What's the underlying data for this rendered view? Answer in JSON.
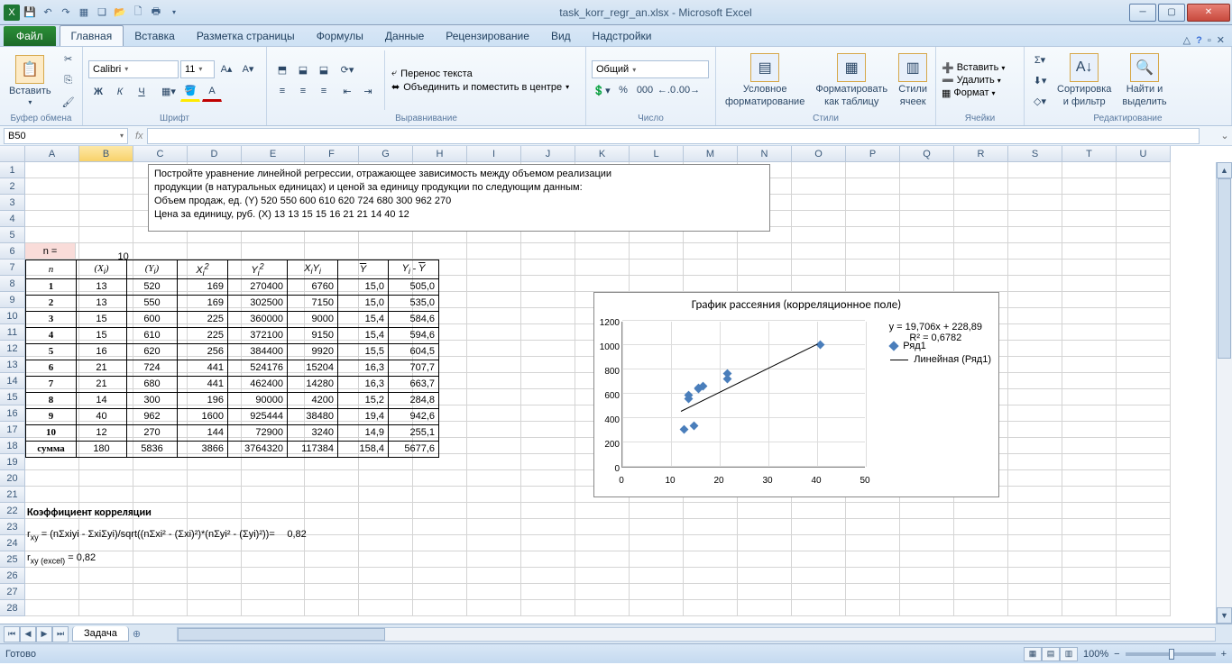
{
  "title": "task_korr_regr_an.xlsx - Microsoft Excel",
  "tabs": {
    "file": "Файл",
    "home": "Главная",
    "insert": "Вставка",
    "layout": "Разметка страницы",
    "formulas": "Формулы",
    "data": "Данные",
    "review": "Рецензирование",
    "view": "Вид",
    "addins": "Надстройки"
  },
  "ribbon": {
    "paste": "Вставить",
    "clipboard": "Буфер обмена",
    "font": "Calibri",
    "size": "11",
    "font_group": "Шрифт",
    "wrap": "Перенос текста",
    "merge": "Объединить и поместить в центре",
    "align_group": "Выравнивание",
    "numfmt": "Общий",
    "num_group": "Число",
    "cond": "Условное",
    "cond2": "форматирование",
    "fmttbl": "Форматировать",
    "fmttbl2": "как таблицу",
    "cellst": "Стили",
    "cellst2": "ячеек",
    "styles_group": "Стили",
    "ins": "Вставить",
    "del": "Удалить",
    "fmt": "Формат",
    "cells_group": "Ячейки",
    "sort": "Сортировка",
    "sort2": "и фильтр",
    "find": "Найти и",
    "find2": "выделить",
    "edit_group": "Редактирование"
  },
  "namebox": "B50",
  "fx": "fx",
  "cols": [
    "A",
    "B",
    "C",
    "D",
    "E",
    "F",
    "G",
    "H",
    "I",
    "J",
    "K",
    "L",
    "M",
    "N",
    "O",
    "P",
    "Q",
    "R",
    "S",
    "T",
    "U"
  ],
  "task": {
    "l1": "Постройте уравнение линейной регрессии, отражающее зависимость между  объемом реализации",
    "l2": "продукции (в натуральных единицах) и ценой за единицу продукции по следующим данным:",
    "l3": "Объем продаж, ед. (Y) 520 550 600 610 620 724 680 300  962 270",
    "l4": "Цена за единицу, руб. (X) 13 13 15 15 16 21 21 14 40 12"
  },
  "nlabel": "n =",
  "nval": "10",
  "headers": {
    "n": "n",
    "xi": "(X",
    "yi": "(Y",
    "xi2": "X",
    "yi2": "Y",
    "xiyi": "X",
    "ybar": "Y̅",
    "ydiff": "Y"
  },
  "rows": [
    {
      "n": "1",
      "xi": "13",
      "yi": "520",
      "xi2": "169",
      "yi2": "270400",
      "xiyi": "6760",
      "yb": "15,0",
      "yd": "505,0"
    },
    {
      "n": "2",
      "xi": "13",
      "yi": "550",
      "xi2": "169",
      "yi2": "302500",
      "xiyi": "7150",
      "yb": "15,0",
      "yd": "535,0"
    },
    {
      "n": "3",
      "xi": "15",
      "yi": "600",
      "xi2": "225",
      "yi2": "360000",
      "xiyi": "9000",
      "yb": "15,4",
      "yd": "584,6"
    },
    {
      "n": "4",
      "xi": "15",
      "yi": "610",
      "xi2": "225",
      "yi2": "372100",
      "xiyi": "9150",
      "yb": "15,4",
      "yd": "594,6"
    },
    {
      "n": "5",
      "xi": "16",
      "yi": "620",
      "xi2": "256",
      "yi2": "384400",
      "xiyi": "9920",
      "yb": "15,5",
      "yd": "604,5"
    },
    {
      "n": "6",
      "xi": "21",
      "yi": "724",
      "xi2": "441",
      "yi2": "524176",
      "xiyi": "15204",
      "yb": "16,3",
      "yd": "707,7"
    },
    {
      "n": "7",
      "xi": "21",
      "yi": "680",
      "xi2": "441",
      "yi2": "462400",
      "xiyi": "14280",
      "yb": "16,3",
      "yd": "663,7"
    },
    {
      "n": "8",
      "xi": "14",
      "yi": "300",
      "xi2": "196",
      "yi2": "90000",
      "xiyi": "4200",
      "yb": "15,2",
      "yd": "284,8"
    },
    {
      "n": "9",
      "xi": "40",
      "yi": "962",
      "xi2": "1600",
      "yi2": "925444",
      "xiyi": "38480",
      "yb": "19,4",
      "yd": "942,6"
    },
    {
      "n": "10",
      "xi": "12",
      "yi": "270",
      "xi2": "144",
      "yi2": "72900",
      "xiyi": "3240",
      "yb": "14,9",
      "yd": "255,1"
    }
  ],
  "sum": {
    "lbl": "сумма",
    "xi": "180",
    "yi": "5836",
    "xi2": "3866",
    "yi2": "3764320",
    "xiyi": "117384",
    "yb": "158,4",
    "yd": "5677,6"
  },
  "corr": {
    "title": "Коэффициент корреляции",
    "formula": "r",
    "formula_text": " = (nΣxiyi - ΣxiΣyi)/sqrt((nΣxi² - (Σxi)²)*(nΣyi² - (Σyi)²))=",
    "val": "0,82",
    "excel_lbl": "r",
    "excel_sub": "xy (excel)",
    "excel_eq": " = ",
    "excel_val": "0,82",
    "sub": "xy"
  },
  "chart": {
    "title": "График рассеяния (корреляционное поле)",
    "eq": "y = 19,706x + 228,89",
    "r2": "R² = 0,6782",
    "leg1": "Ряд1",
    "leg2": "Линейная (Ряд1)"
  },
  "chart_data": {
    "type": "scatter",
    "title": "График рассеяния (корреляционное поле)",
    "x": [
      13,
      13,
      15,
      15,
      16,
      21,
      21,
      14,
      40,
      12
    ],
    "y": [
      520,
      550,
      600,
      610,
      620,
      724,
      680,
      300,
      962,
      270
    ],
    "xlim": [
      0,
      50
    ],
    "ylim": [
      0,
      1200
    ],
    "xticks": [
      0,
      10,
      20,
      30,
      40,
      50
    ],
    "yticks": [
      0,
      200,
      400,
      600,
      800,
      1000,
      1200
    ],
    "trendline": {
      "slope": 19.706,
      "intercept": 228.89,
      "r2": 0.6782
    },
    "series": [
      {
        "name": "Ряд1"
      },
      {
        "name": "Линейная (Ряд1)"
      }
    ]
  },
  "sheet": "Задача",
  "status": "Готово",
  "zoom": "100%"
}
